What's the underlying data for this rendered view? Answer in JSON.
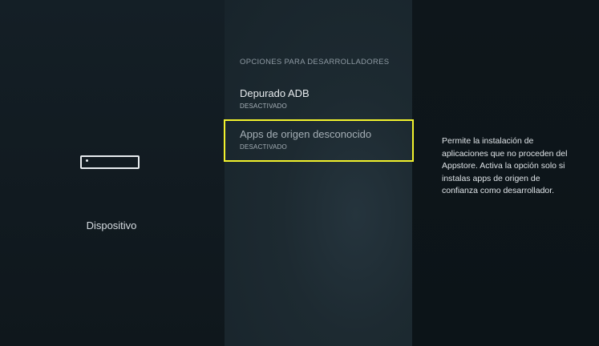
{
  "sidebar": {
    "category_label": "Dispositivo",
    "category_icon": "device-icon"
  },
  "section": {
    "header": "OPCIONES PARA DESARROLLADORES",
    "items": [
      {
        "title": "Depurado ADB",
        "status": "DESACTIVADO"
      },
      {
        "title": "Apps de origen desconocido",
        "status": "DESACTIVADO",
        "focused": true
      }
    ]
  },
  "description": "Permite la instalación de aplicaciones que no proceden del Appstore. Activa la opción solo si instalas apps de origen de confianza como desarrollador.",
  "colors": {
    "focus": "#f2f22d",
    "background": "#0f171d"
  }
}
